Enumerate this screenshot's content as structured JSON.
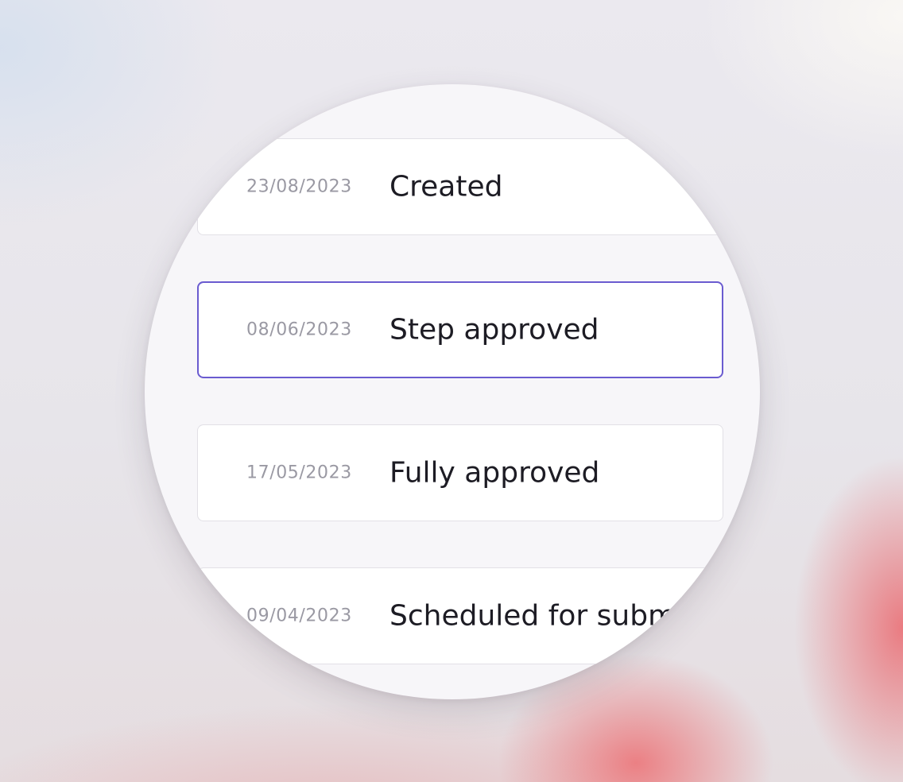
{
  "history": {
    "items": [
      {
        "date": "23/08/2023",
        "event": "Created",
        "selected": false
      },
      {
        "date": "08/06/2023",
        "event": "Step approved",
        "selected": true
      },
      {
        "date": "17/05/2023",
        "event": "Fully approved",
        "selected": false
      },
      {
        "date": "09/04/2023",
        "event": "Scheduled for submission",
        "selected": false
      }
    ]
  },
  "colors": {
    "selected_border": "#6a5bd0",
    "date_text": "#9a99a3",
    "event_text": "#1d1c24",
    "panel_bg": "#f7f6f9"
  }
}
